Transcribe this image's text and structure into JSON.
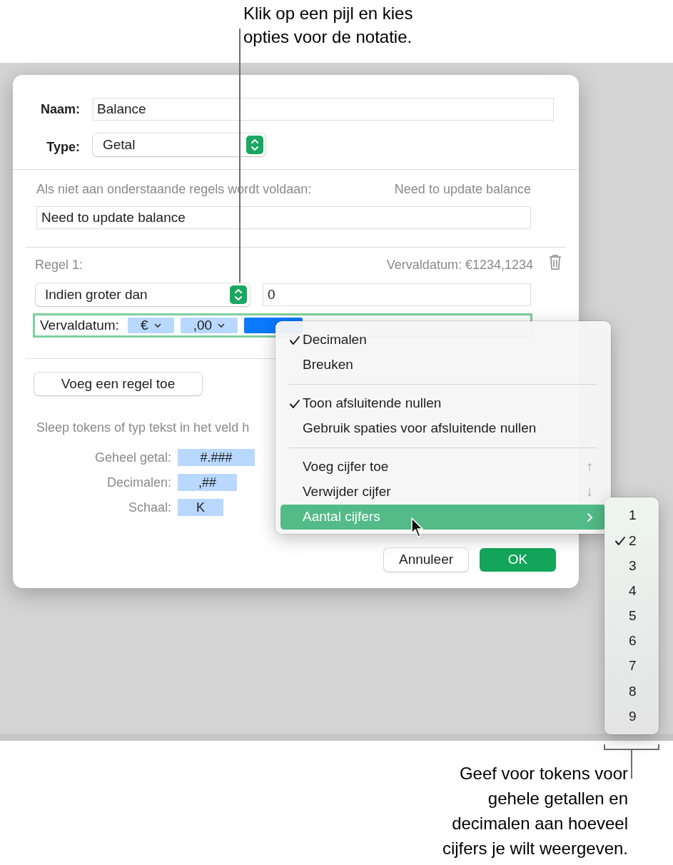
{
  "callouts": [
    {
      "lines": [
        "Klik op een pijl en kies",
        "opties voor de notatie."
      ]
    },
    {
      "lines": [
        "Geef voor tokens voor",
        "gehele getallen en",
        "decimalen aan hoeveel",
        "cijfers je wilt weergeven."
      ]
    }
  ],
  "dialog": {
    "name": {
      "label": "Naam:",
      "value": "Balance"
    },
    "type": {
      "label": "Type:",
      "value": "Getal"
    },
    "fallback": {
      "label": "Als niet aan onderstaande regels wordt voldaan:",
      "preview": "Need to update balance",
      "value": "Need to update balance"
    },
    "rule": {
      "title": "Regel 1:",
      "preview": "Vervaldatum: €1234,1234",
      "condition": "Indien groter dan",
      "value": "0",
      "format": {
        "label": "Vervaldatum:",
        "tokens": [
          {
            "text": "€",
            "selected": false
          },
          {
            "text": ",00",
            "selected": false
          },
          {
            "selected": true
          }
        ]
      }
    },
    "add_rule_button": "Voeg een regel toe",
    "hint": "Sleep tokens of typ tekst in het veld h",
    "token_legend": [
      {
        "label": "Geheel getal:",
        "token": "#.###"
      },
      {
        "label": "Decimalen:",
        "token": ",##"
      },
      {
        "label": "Schaal:",
        "token": "K"
      }
    ],
    "buttons": [
      {
        "label": "Annuleer",
        "kind": "secondary"
      },
      {
        "label": "OK",
        "kind": "primary"
      }
    ]
  },
  "menu": {
    "items": [
      {
        "kind": "item",
        "label": "Decimalen",
        "checked": true,
        "selected": false
      },
      {
        "kind": "item",
        "label": "Breuken",
        "checked": false,
        "selected": false
      },
      {
        "kind": "separator"
      },
      {
        "kind": "item",
        "label": "Toon afsluitende nullen",
        "checked": true,
        "selected": false
      },
      {
        "kind": "item",
        "label": "Gebruik spaties voor afsluitende nullen",
        "checked": false,
        "selected": false
      },
      {
        "kind": "separator"
      },
      {
        "kind": "item",
        "label": "Voeg cijfer toe",
        "shortcut": "↑",
        "checked": false,
        "selected": false
      },
      {
        "kind": "item",
        "label": "Verwijder cijfer",
        "shortcut": "↓",
        "checked": false,
        "selected": false
      },
      {
        "kind": "submenu",
        "label": "Aantal cijfers",
        "checked": false,
        "selected": true
      }
    ]
  },
  "submenu": {
    "items": [
      {
        "label": "1",
        "checked": false
      },
      {
        "label": "2",
        "checked": true
      },
      {
        "label": "3",
        "checked": false
      },
      {
        "label": "4",
        "checked": false
      },
      {
        "label": "5",
        "checked": false
      },
      {
        "label": "6",
        "checked": false
      },
      {
        "label": "7",
        "checked": false
      },
      {
        "label": "8",
        "checked": false
      },
      {
        "label": "9",
        "checked": false
      }
    ]
  }
}
